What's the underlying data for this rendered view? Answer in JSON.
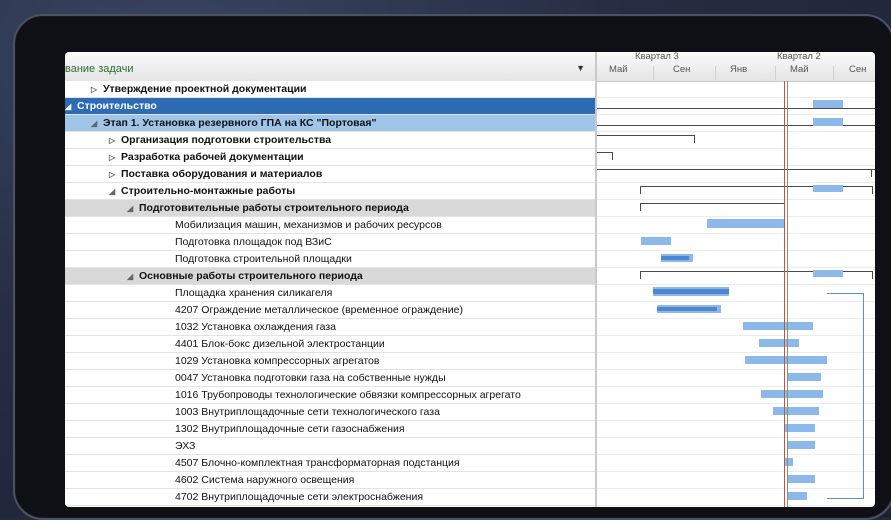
{
  "task_column": {
    "title": "вание задачи",
    "sort_icon": "▼"
  },
  "timeline": {
    "quarters": [
      "Квартал 3",
      "Квартал 2"
    ],
    "months": [
      "Май",
      "Сен",
      "Янв",
      "Май",
      "Сен"
    ]
  },
  "rows": [
    {
      "label": "Утверждение проектной документации",
      "style": "task",
      "indent": 1,
      "toggle": "▷",
      "bold": true
    },
    {
      "label": "Строительство",
      "style": "sel",
      "indent": 0,
      "toggle": "◢"
    },
    {
      "label": "Этап 1. Установка резервного ГПА на КС \"Портовая\"",
      "style": "hl",
      "indent": 1,
      "toggle": "◢"
    },
    {
      "label": "Организация подготовки строительства",
      "style": "task",
      "indent": 2,
      "toggle": "▷",
      "bold": true
    },
    {
      "label": "Разработка рабочей документации",
      "style": "task",
      "indent": 2,
      "toggle": "▷",
      "bold": true
    },
    {
      "label": "Поставка оборудования и материалов",
      "style": "task",
      "indent": 2,
      "toggle": "▷",
      "bold": true
    },
    {
      "label": "Строительно-монтажные работы",
      "style": "task",
      "indent": 2,
      "toggle": "◢",
      "bold": true
    },
    {
      "label": "Подготовительные работы строительного периода",
      "style": "grp",
      "indent": 3,
      "toggle": "◢"
    },
    {
      "label": "Мобилизация машин, механизмов и рабочих ресурсов",
      "style": "task",
      "indent": 5,
      "toggle": ""
    },
    {
      "label": "Подготовка площадок под ВЗиС",
      "style": "task",
      "indent": 5,
      "toggle": ""
    },
    {
      "label": "Подготовка строительной площадки",
      "style": "task",
      "indent": 5,
      "toggle": ""
    },
    {
      "label": "Основные работы строительного периода",
      "style": "grp",
      "indent": 3,
      "toggle": "◢"
    },
    {
      "label": "Площадка хранения силикагеля",
      "style": "task",
      "indent": 5,
      "toggle": ""
    },
    {
      "label": "4207 Ограждение металлическое (временное ограждение)",
      "style": "task",
      "indent": 5,
      "toggle": ""
    },
    {
      "label": "1032 Установка охлаждения газа",
      "style": "task",
      "indent": 5,
      "toggle": ""
    },
    {
      "label": "4401 Блок-бокс дизельной электростанции",
      "style": "task",
      "indent": 5,
      "toggle": ""
    },
    {
      "label": "1029 Установка компрессорных агрегатов",
      "style": "task",
      "indent": 5,
      "toggle": ""
    },
    {
      "label": "0047 Установка подготовки газа на собственные нужды",
      "style": "task",
      "indent": 5,
      "toggle": ""
    },
    {
      "label": "1016 Трубопроводы технологические обвязки компрессорных агрегато",
      "style": "task",
      "indent": 5,
      "toggle": ""
    },
    {
      "label": "1003 Внутриплощадочные сети технологического газа",
      "style": "task",
      "indent": 5,
      "toggle": ""
    },
    {
      "label": "1302 Внутриплощадочные сети газоснабжения",
      "style": "task",
      "indent": 5,
      "toggle": ""
    },
    {
      "label": "ЭХЗ",
      "style": "task",
      "indent": 5,
      "toggle": ""
    },
    {
      "label": "4507 Блочно-комплектная трансформаторная подстанция",
      "style": "task",
      "indent": 5,
      "toggle": ""
    },
    {
      "label": "4602 Система наружного освещения",
      "style": "task",
      "indent": 5,
      "toggle": ""
    },
    {
      "label": "4702 Внутриплощадочные сети электроснабжения",
      "style": "task",
      "indent": 5,
      "toggle": ""
    }
  ]
}
